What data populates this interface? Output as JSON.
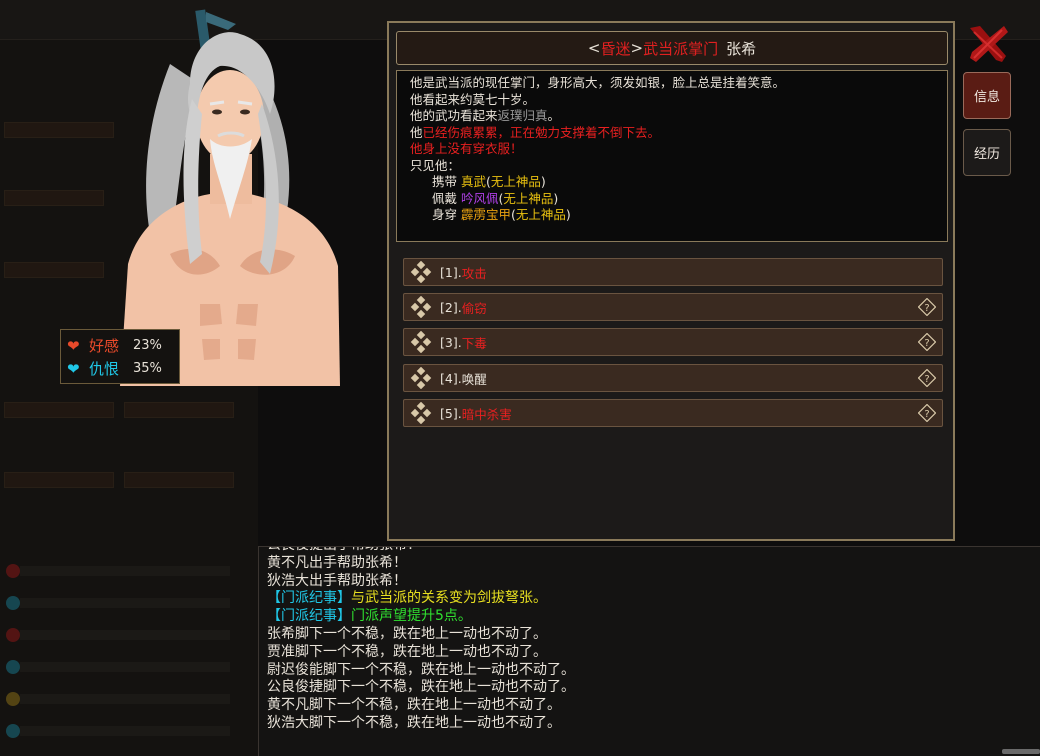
{
  "colors": {
    "panel_border": "#8a7a5a",
    "red": "#e82020",
    "gold": "#e8c010",
    "purple": "#b040e8",
    "cyan": "#20c8e8",
    "yellow": "#e8e020",
    "green": "#30e030",
    "active_tab": "#5a1c14"
  },
  "affinity": {
    "favor_label": "好感",
    "favor_value": "23%",
    "hatred_label": "仇恨",
    "hatred_value": "35%"
  },
  "title": {
    "open_bracket": "<",
    "status": "昏迷",
    "close_bracket": ">",
    "rank": "武当派掌门",
    "name": "张希"
  },
  "description": {
    "line1": "他是武当派的现任掌门，身形高大，须发如银，脸上总是挂着笑意。",
    "line2": "他看起来约莫七十岁。",
    "line3_prefix": "他的武功看起来",
    "line3_level": "返璞归真",
    "line3_suffix": "。",
    "line4_prefix": "他",
    "line4_rest": "已经伤痕累累，正在勉力支撑着不倒下去。",
    "line5": "他身上没有穿衣服！",
    "line6": "只见他：",
    "equip": [
      {
        "verb": "携带",
        "item": "真武",
        "grade": "无上神品",
        "color": "gold"
      },
      {
        "verb": "佩戴",
        "item": "吟风佩",
        "grade": "无上神品",
        "color": "purple"
      },
      {
        "verb": "身穿",
        "item": "霹雳宝甲",
        "grade": "无上神品",
        "color": "orange"
      }
    ],
    "open_paren": "(",
    "close_paren": ")"
  },
  "actions": [
    {
      "num": "[1].",
      "label": "攻击",
      "color": "red",
      "has_help": false
    },
    {
      "num": "[2].",
      "label": "偷窃",
      "color": "red",
      "has_help": true
    },
    {
      "num": "[3].",
      "label": "下毒",
      "color": "red",
      "has_help": true
    },
    {
      "num": "[4].",
      "label": "唤醒",
      "color": "white",
      "has_help": true
    },
    {
      "num": "[5].",
      "label": "暗中杀害",
      "color": "red",
      "has_help": true
    }
  ],
  "tabs": {
    "info": "信息",
    "history": "经历"
  },
  "icons": {
    "close": "close-x-icon",
    "heart": "heart-icon",
    "diamond": "diamond-cluster-icon",
    "help": "question-diamond-icon"
  },
  "log": [
    {
      "text": "公良俊捷出手帮助张希！",
      "color": "white"
    },
    {
      "text": "黄不凡出手帮助张希！",
      "color": "white"
    },
    {
      "text": "狄浩大出手帮助张希！",
      "color": "white"
    },
    {
      "tag": "【门派纪事】",
      "text": "与武当派的关系变为剑拔弩张。",
      "tag_color": "cyan",
      "color": "yellow"
    },
    {
      "tag": "【门派纪事】",
      "text": "门派声望提升5点。",
      "tag_color": "cyan",
      "color": "green"
    },
    {
      "text": "张希脚下一个不稳，跌在地上一动也不动了。",
      "color": "white"
    },
    {
      "text": "贾准脚下一个不稳，跌在地上一动也不动了。",
      "color": "white"
    },
    {
      "text": "尉迟俊能脚下一个不稳，跌在地上一动也不动了。",
      "color": "white"
    },
    {
      "text": "公良俊捷脚下一个不稳，跌在地上一动也不动了。",
      "color": "white"
    },
    {
      "text": "黄不凡脚下一个不稳，跌在地上一动也不动了。",
      "color": "white"
    },
    {
      "text": "狄浩大脚下一个不稳，跌在地上一动也不动了。",
      "color": "white"
    }
  ]
}
